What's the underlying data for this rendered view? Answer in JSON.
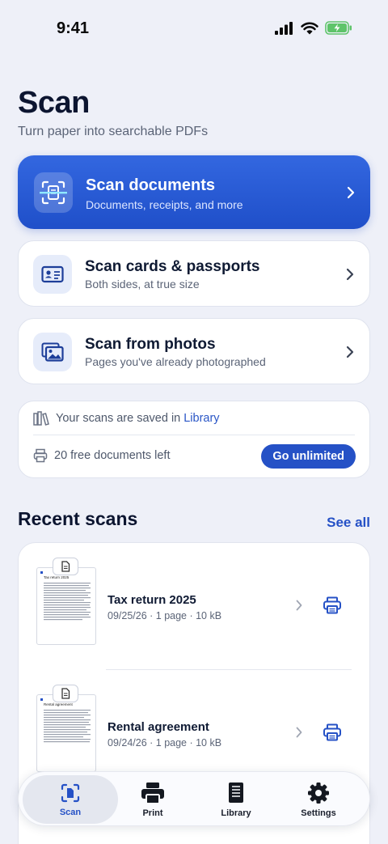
{
  "status": {
    "time": "9:41"
  },
  "header": {
    "title": "Scan",
    "subtitle": "Turn paper into searchable PDFs"
  },
  "options": {
    "primary": {
      "title": "Scan documents",
      "subtitle": "Documents, receipts, and more"
    },
    "cards": {
      "title": "Scan cards & passports",
      "subtitle": "Both sides, at true size"
    },
    "photos": {
      "title": "Scan from photos",
      "subtitle": "Pages you've already photographed"
    }
  },
  "info": {
    "saved_text": "Your scans are saved in",
    "saved_link": "Library",
    "free_left": "20 free documents left",
    "unlimited_button": "Go unlimited"
  },
  "recent": {
    "title": "Recent scans",
    "see_all": "See all",
    "items": [
      {
        "name": "Tax return 2025",
        "meta": "09/25/26 · 1 page · 10 kB",
        "thumb_heading": "Tax return 2025"
      },
      {
        "name": "Rental agreement",
        "meta": "09/24/26 · 1 page · 10 kB",
        "thumb_heading": "Rental agreement"
      }
    ]
  },
  "tabs": [
    {
      "label": "Scan",
      "icon": "scan-icon",
      "active": true
    },
    {
      "label": "Print",
      "icon": "printer-icon",
      "active": false
    },
    {
      "label": "Library",
      "icon": "library-icon",
      "active": false
    },
    {
      "label": "Settings",
      "icon": "gear-icon",
      "active": false
    }
  ],
  "colors": {
    "accent": "#2551c6",
    "background": "#eef0f8"
  }
}
